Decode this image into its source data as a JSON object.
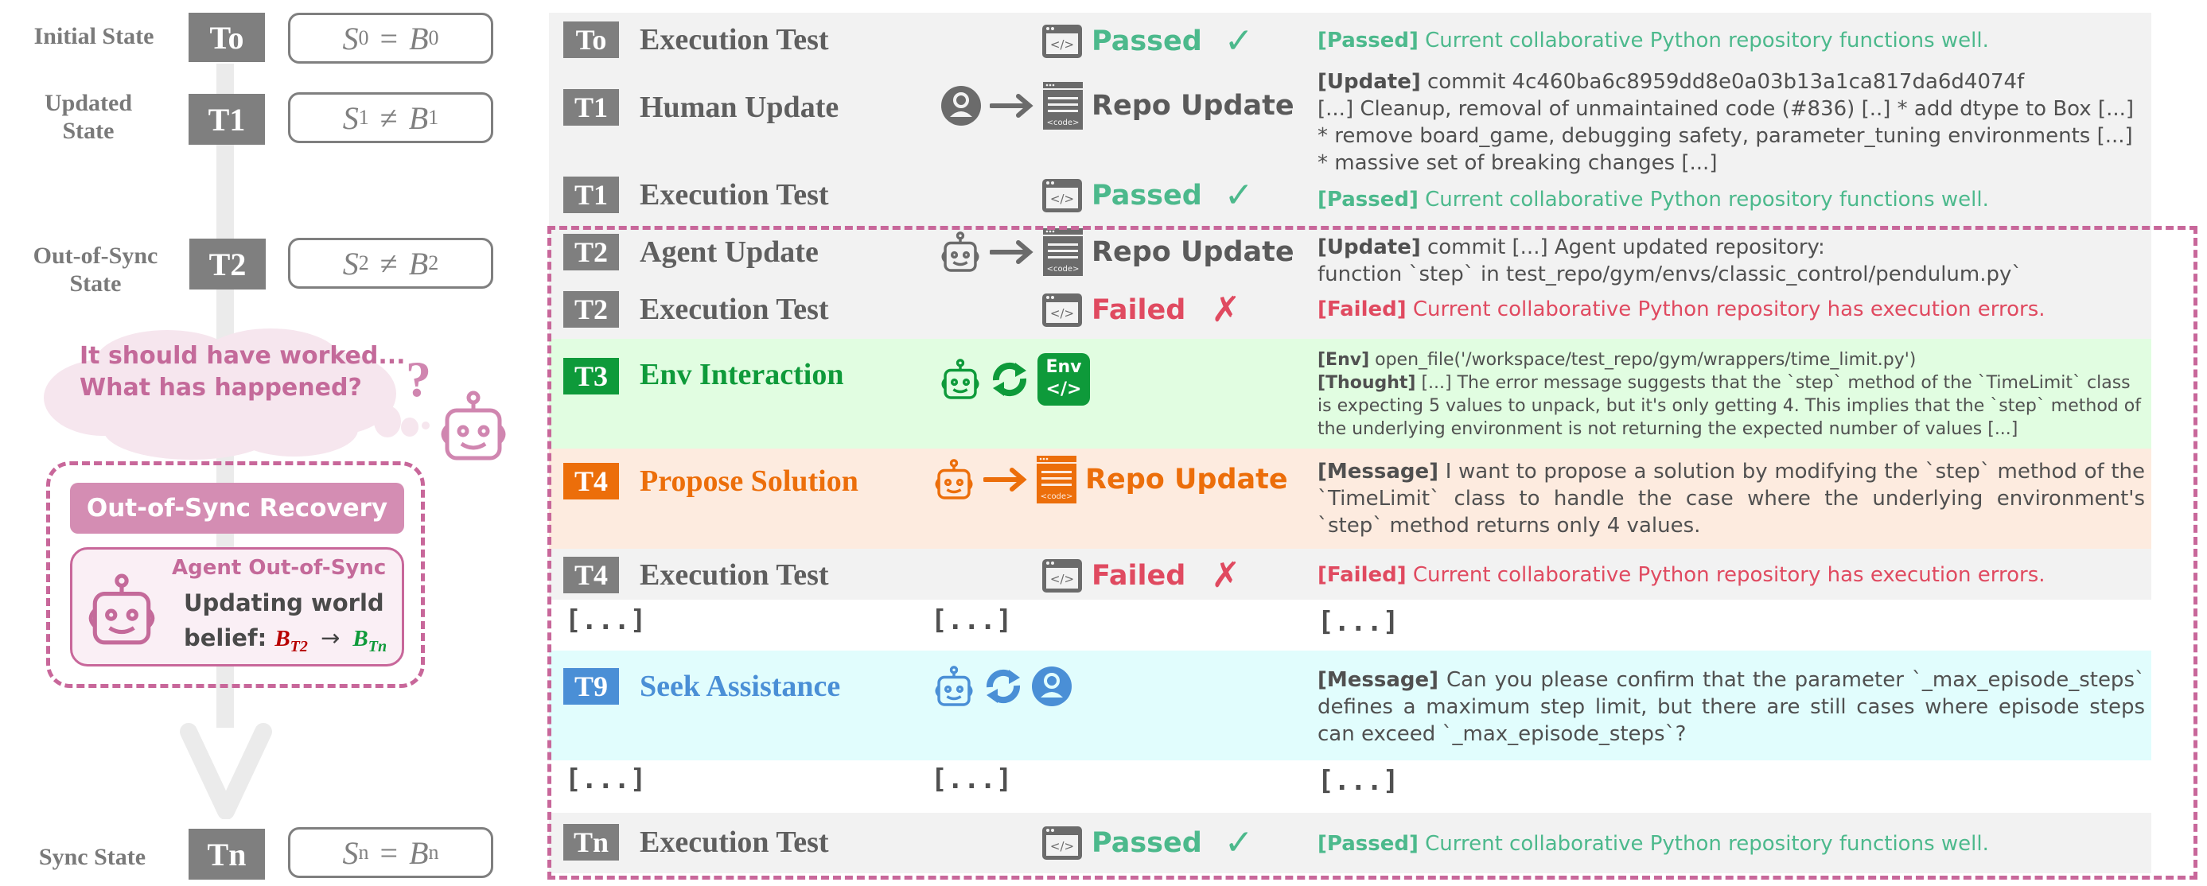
{
  "timeline": {
    "states": [
      {
        "label": "Initial State",
        "badge": "To",
        "formula_lhs": "S",
        "lhs_sub": "0",
        "op": "=",
        "formula_rhs": "B",
        "rhs_sub": "0"
      },
      {
        "label": "Updated State",
        "badge": "T1",
        "formula_lhs": "S",
        "lhs_sub": "1",
        "op": "≠",
        "formula_rhs": "B",
        "rhs_sub": "1"
      },
      {
        "label": "Out-of-Sync State",
        "badge": "T2",
        "formula_lhs": "S",
        "lhs_sub": "2",
        "op": "≠",
        "formula_rhs": "B",
        "rhs_sub": "2"
      },
      {
        "label": "Sync State",
        "badge": "Tn",
        "formula_lhs": "S",
        "lhs_sub": "n",
        "op": "=",
        "formula_rhs": "B",
        "rhs_sub": "n"
      }
    ],
    "thought": {
      "line1": "It should have worked...",
      "line2": "What has happened?",
      "question": "?"
    },
    "recovery": {
      "title": "Out-of-Sync Recovery",
      "card_title": "Agent Out-of-Sync",
      "line1": "Updating world",
      "line2_prefix": "belief:",
      "from_symbol": "B",
      "from_sub": "T2",
      "arrow": "→",
      "to_symbol": "B",
      "to_sub": "Tn"
    }
  },
  "colors": {
    "pass": "#4cb98c",
    "fail": "#e04a60",
    "neutral": "#6b6b6b",
    "env_green": "#0e9a3a",
    "propose_orange": "#ec6e0a",
    "assist_blue": "#4a8fd6",
    "sync_pink": "#c8679a"
  },
  "steps": [
    {
      "badge": "To",
      "title": "Execution Test",
      "action": "Passed",
      "mark": "✓",
      "desc_tag": "[Passed]",
      "desc": " Current collaborative Python repository functions well."
    },
    {
      "badge": "T1",
      "title": "Human Update",
      "action": "Repo Update",
      "desc_tag": "[Update]",
      "desc": " commit 4c460ba6c8959dd8e0a03b13a1ca817da6d4074f",
      "desc_lines": [
        "[...] Cleanup, removal of unmaintained code (#836) [..] * add dtype to Box [...]",
        "* remove board_game, debugging safety, parameter_tuning environments [...]",
        "* massive set of breaking changes [...]"
      ]
    },
    {
      "badge": "T1",
      "title": "Execution Test",
      "action": "Passed",
      "mark": "✓",
      "desc_tag": "[Passed]",
      "desc": " Current collaborative Python repository functions well."
    },
    {
      "badge": "T2",
      "title": "Agent Update",
      "action": "Repo Update",
      "desc_tag": "[Update]",
      "desc": " commit [...] Agent updated repository:",
      "desc_lines": [
        "function `step` in test_repo/gym/envs/classic_control/pendulum.py`"
      ]
    },
    {
      "badge": "T2",
      "title": "Execution Test",
      "action": "Failed",
      "mark": "✗",
      "desc_tag": "[Failed]",
      "desc": " Current collaborative Python repository has execution errors."
    },
    {
      "badge": "T3",
      "title": "Env Interaction",
      "env_label": "Env",
      "env_code": "</>",
      "desc_tag": "[Env]",
      "desc": " open_file('/workspace/test_repo/gym/wrappers/time_limit.py')",
      "desc_tag2": "[Thought]",
      "desc2": " [...] The error message suggests that the `step` method of the `TimeLimit` class is expecting 5 values to unpack, but it's only getting 4. This implies that the `step` method of the underlying environment is not returning the expected number of values [...]"
    },
    {
      "badge": "T4",
      "title": "Propose Solution",
      "action": "Repo Update",
      "desc_tag": "[Message]",
      "desc": " I want to propose a solution by modifying the `step` method of the `TimeLimit` class to handle the case where the underlying environment's `step` method returns only 4 values."
    },
    {
      "badge": "T4",
      "title": "Execution Test",
      "action": "Failed",
      "mark": "✗",
      "desc_tag": "[Failed]",
      "desc": " Current collaborative Python repository has execution errors."
    },
    {
      "ellipsis": "[...]"
    },
    {
      "badge": "T9",
      "title": "Seek Assistance",
      "desc_tag": "[Message]",
      "desc": " Can you please confirm that the parameter `_max_episode_steps` defines a maximum step limit, but there are still cases where episode steps can exceed `_max_episode_steps`?"
    },
    {
      "ellipsis": "[...]"
    },
    {
      "badge": "Tn",
      "title": "Execution Test",
      "action": "Passed",
      "mark": "✓",
      "desc_tag": "[Passed]",
      "desc": " Current collaborative Python repository functions well."
    }
  ],
  "icons": {
    "code_window": "</>",
    "code_doc": "<code>"
  }
}
